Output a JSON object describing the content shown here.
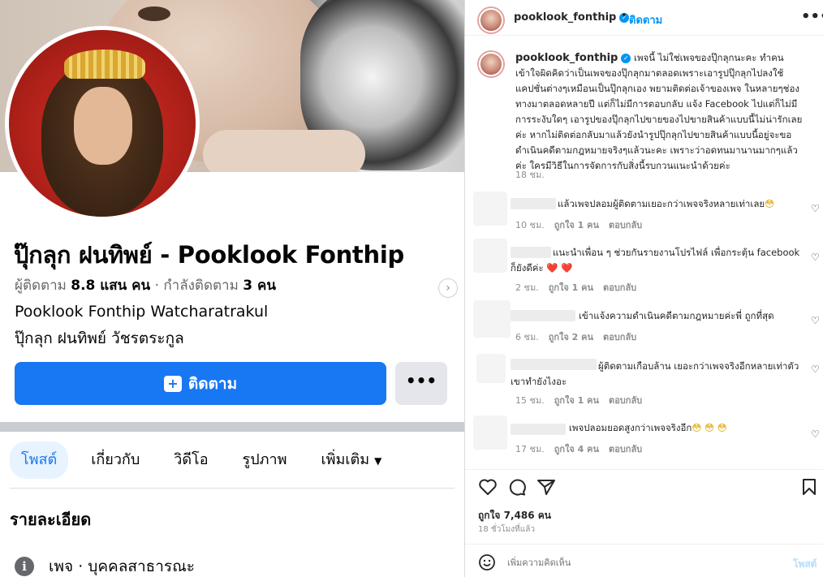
{
  "facebook": {
    "name": "ปุ๊กลุก ฝนทิพย์ - Pooklook Fonthip",
    "followers_label": "ผู้ติดตาม",
    "followers_value": "8.8 แสน คน",
    "following_label": "กำลังติดตาม",
    "following_value": "3 คน",
    "name_en": "Pooklook Fonthip Watcharatrakul",
    "name_th": "ปุ๊กลุก ฝนทิพย์ วัชรตระกูล",
    "follow_button": "ติดตาม",
    "more_button": "•••",
    "tabs": [
      "โพสต์",
      "เกี่ยวกับ",
      "วิดีโอ",
      "รูปภาพ",
      "เพิ่มเติม"
    ],
    "details_heading": "รายละเอียด",
    "page_type": "เพจ · บุคคลสาธารณะ",
    "icons": {
      "next": "chevron-right-icon",
      "follow": "add-follow-icon",
      "info": "info-icon",
      "dropdown": "caret-down-icon"
    },
    "colors": {
      "primary": "#1877f2",
      "secondary_button": "#e4e6eb",
      "tab_active_bg": "#e7f3ff"
    }
  },
  "instagram": {
    "username": "pooklook_fonthip",
    "follow_label": "ติดตาม",
    "caption": "เพจนี้ ไม่ใช่เพจของปุ๊กลุกนะคะ ทำคนเข้าใจผิดคิดว่าเป็นเพจของปุ๊กลุกมาตลอดเพราะเอารูปปุ๊กลุกไปลงใช้แคปชั่นต่างๆเหมือนเป็นปุ๊กลุกเอง พยามติดต่อเจ้าของเพจ ในหลายๆช่องทางมาตลอดหลายปี แต่ก็ไม่มีการตอบกลับ แจ้ง Facebook ไปแต่ก็ไม่มีการระงับใดๆ เอารูปของปุ๊กลุกไปขายของไปขายสินค้าแบบนี้ไม่น่ารักเลยค่ะ หากไม่ติดต่อกลับมาแล้วยังนำรูปปุ๊กลุกไปขายสินค้าแบบนี้อยู่จะขอดำเนินคดีตามกฎหมายจริงๆแล้วนะคะ เพราะว่าอดทนมานานมากๆแล้วค่ะ ใครมีวิธีในการจัดการกับสิ่งนี้รบกวนแนะนำด้วยค่ะ",
    "caption_time": "18 ชม.",
    "comments": [
      {
        "text": "แล้วเพจปลอมผู้ติดตามเยอะกว่าเพจจริงหลายเท่าเลย",
        "emoji": "😳",
        "time": "10 ชม.",
        "likes": "ถูกใจ 1 คน",
        "reply": "ตอบกลับ"
      },
      {
        "text": "แนะนำเพื่อน ๆ ช่วยกันรายงานโปรไฟล์ เพื่อกระตุ้น facebook ก็ยังดีค่ะ",
        "emoji": "❤️ ❤️",
        "time": "2 ชม.",
        "likes": "ถูกใจ 1 คน",
        "reply": "ตอบกลับ"
      },
      {
        "text": "เข้าแจ้งความดำเนินคดีตามกฎหมายค่ะพี่ ถูกที่สุด",
        "emoji": "",
        "time": "6 ชม.",
        "likes": "ถูกใจ 2 คน",
        "reply": "ตอบกลับ"
      },
      {
        "text": "ผู้ติดตามเกือบล้าน เยอะกว่าเพจจริงอีกหลายเท่าตัว เขาทำยังไงอะ",
        "emoji": "",
        "time": "15 ชม.",
        "likes": "ถูกใจ 1 คน",
        "reply": "ตอบกลับ"
      },
      {
        "text": "เพจปลอมยอดสูงกว่าเพจจริงอีก",
        "emoji": "😳 😳 😳",
        "time": "17 ชม.",
        "likes": "ถูกใจ 4 คน",
        "reply": "ตอบกลับ"
      }
    ],
    "likes_count": "ถูกใจ 7,486 คน",
    "posted_ago": "18 ชั่วโมงที่แล้ว",
    "comment_placeholder": "เพิ่มความคิดเห็น",
    "post_button": "โพสต์",
    "more_icon": "•••",
    "icons": [
      "verified-badge-icon",
      "more-options-icon",
      "heart-icon",
      "comment-icon",
      "share-icon",
      "save-icon",
      "emoji-icon"
    ],
    "colors": {
      "link_blue": "#0095f6",
      "post_disabled": "#b2dffc",
      "meta_gray": "#8e8e8e"
    }
  }
}
